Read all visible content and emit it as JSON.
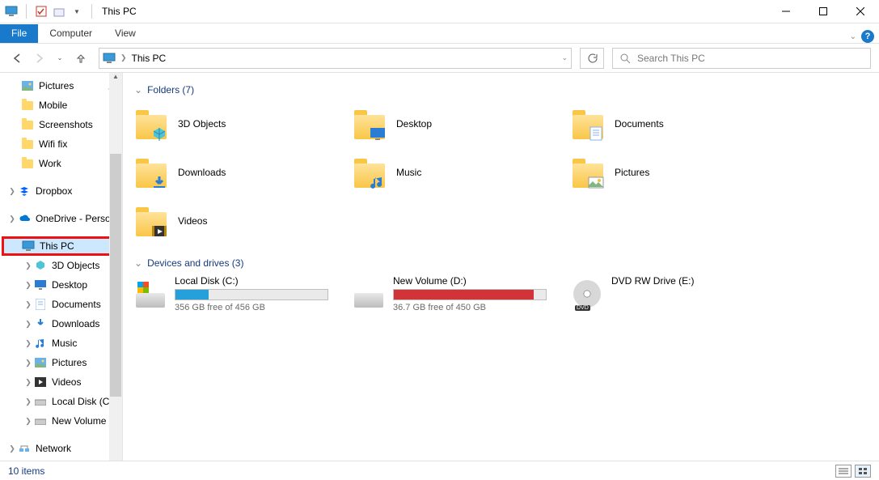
{
  "window": {
    "title": "This PC"
  },
  "tabs": {
    "file": "File",
    "computer": "Computer",
    "view": "View"
  },
  "address": {
    "crumb": "This PC"
  },
  "search": {
    "placeholder": "Search This PC"
  },
  "sidebar": {
    "quick": [
      {
        "label": "Pictures",
        "pinned": true,
        "icon": "pictures"
      },
      {
        "label": "Mobile",
        "pinned": false,
        "icon": "folder"
      },
      {
        "label": "Screenshots",
        "pinned": false,
        "icon": "folder"
      },
      {
        "label": "Wifi fix",
        "pinned": false,
        "icon": "folder"
      },
      {
        "label": "Work",
        "pinned": false,
        "icon": "folder"
      }
    ],
    "dropbox": "Dropbox",
    "onedrive": "OneDrive - Person",
    "thispc": "This PC",
    "pc_children": [
      {
        "label": "3D Objects",
        "icon": "3d"
      },
      {
        "label": "Desktop",
        "icon": "desktop"
      },
      {
        "label": "Documents",
        "icon": "documents"
      },
      {
        "label": "Downloads",
        "icon": "downloads"
      },
      {
        "label": "Music",
        "icon": "music"
      },
      {
        "label": "Pictures",
        "icon": "pictures"
      },
      {
        "label": "Videos",
        "icon": "videos"
      },
      {
        "label": "Local Disk (C:)",
        "icon": "drive"
      },
      {
        "label": "New Volume (D:",
        "icon": "drive"
      }
    ],
    "network": "Network"
  },
  "sections": {
    "folders_title": "Folders (7)",
    "drives_title": "Devices and drives (3)"
  },
  "folders": [
    {
      "label": "3D Objects",
      "overlay": "3d"
    },
    {
      "label": "Desktop",
      "overlay": "desktop"
    },
    {
      "label": "Documents",
      "overlay": "documents"
    },
    {
      "label": "Downloads",
      "overlay": "downloads"
    },
    {
      "label": "Music",
      "overlay": "music"
    },
    {
      "label": "Pictures",
      "overlay": "pictures"
    },
    {
      "label": "Videos",
      "overlay": "videos"
    }
  ],
  "drives": [
    {
      "label": "Local Disk (C:)",
      "free": "356 GB free of 456 GB",
      "fill_pct": 22,
      "color": "#26a0da",
      "icon": "win"
    },
    {
      "label": "New Volume (D:)",
      "free": "36.7 GB free of 450 GB",
      "fill_pct": 92,
      "color": "#d13438",
      "icon": "hdd"
    },
    {
      "label": "DVD RW Drive (E:)",
      "free": "",
      "fill_pct": 0,
      "color": "",
      "icon": "dvd"
    }
  ],
  "status": {
    "text": "10 items"
  }
}
